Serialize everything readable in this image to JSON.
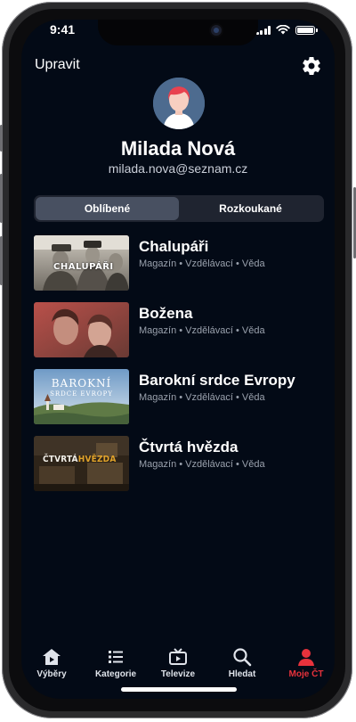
{
  "status": {
    "time": "9:41"
  },
  "header": {
    "edit_label": "Upravit",
    "settings_icon": "gear-icon"
  },
  "profile": {
    "name": "Milada Nová",
    "email": "milada.nova@seznam.cz"
  },
  "tabs": [
    {
      "label": "Oblíbené",
      "selected": true
    },
    {
      "label": "Rozkoukané",
      "selected": false
    }
  ],
  "favorites": [
    {
      "title": "Chalupáři",
      "meta": "Magazín • Vzdělávací • Věda",
      "thumb_text": "CHALUPÁŘI"
    },
    {
      "title": "Božena",
      "meta": "Magazín • Vzdělávací • Věda",
      "thumb_text": ""
    },
    {
      "title": "Barokní srdce Evropy",
      "meta": "Magazín • Vzdělávací • Věda",
      "thumb_text": "BAROKNÍ",
      "thumb_text2": "SRDCE EVROPY"
    },
    {
      "title": "Čtvrtá hvězda",
      "meta": "Magazín • Vzdělávací • Věda",
      "thumb_text": "ČTVRTÁ",
      "thumb_text2": "HVĚZDA"
    }
  ],
  "tabbar": [
    {
      "label": "Výběry",
      "icon": "home-icon"
    },
    {
      "label": "Kategorie",
      "icon": "list-icon"
    },
    {
      "label": "Televize",
      "icon": "tv-icon"
    },
    {
      "label": "Hledat",
      "icon": "search-icon"
    },
    {
      "label": "Moje ČT",
      "icon": "user-icon",
      "active": true
    }
  ],
  "colors": {
    "background": "#030a16",
    "accent": "#e8323c",
    "segment_active": "#485061"
  }
}
